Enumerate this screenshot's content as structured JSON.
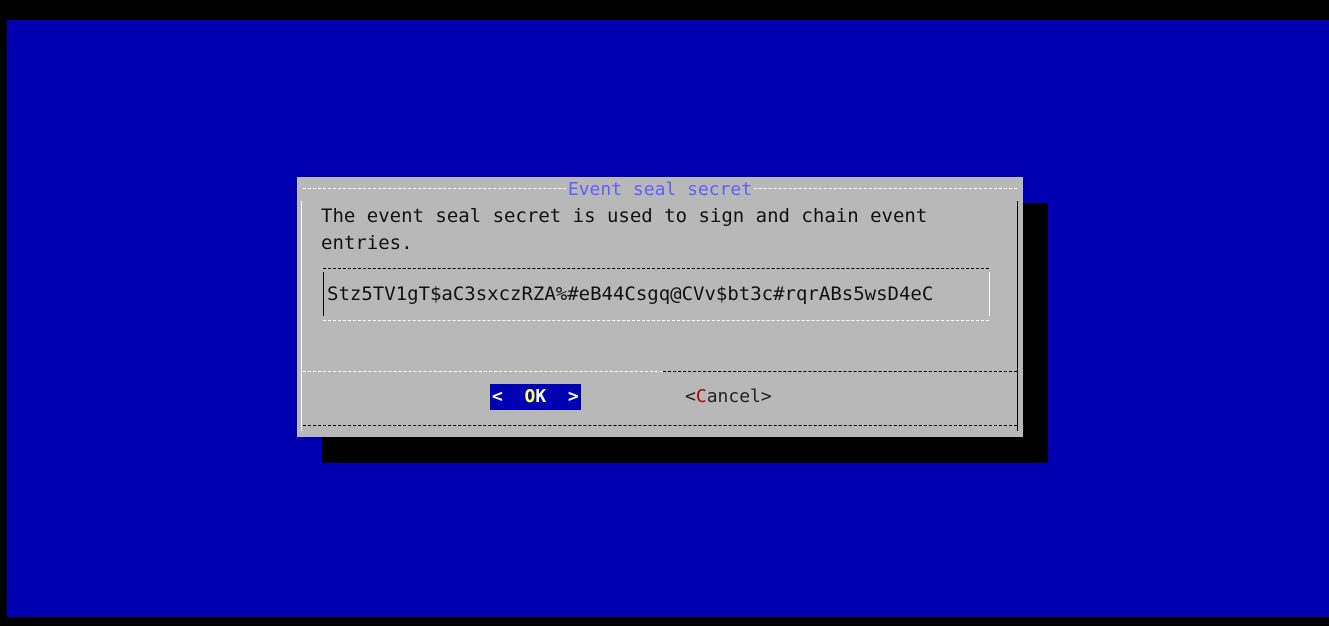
{
  "dialog": {
    "title": "Event seal secret",
    "description": "The event seal secret is used to sign and chain event entries.",
    "input_value": "Stz5TV1gT$aC3sxczRZA%#eB44Csgq@CVv$bt3c#rqrABs5wsD4eC",
    "ok_button": {
      "left": "<  ",
      "hotkey": "O",
      "rest": "K",
      "right": "  >"
    },
    "cancel_button": {
      "left": "<",
      "hotkey": "C",
      "rest": "ancel",
      "right": ">"
    }
  },
  "colors": {
    "background": "#0000b2",
    "dialog_bg": "#b8b8b8",
    "title": "#5f5fff",
    "hotkey_selected": "#ffff55",
    "hotkey_unselected": "#b00000"
  }
}
